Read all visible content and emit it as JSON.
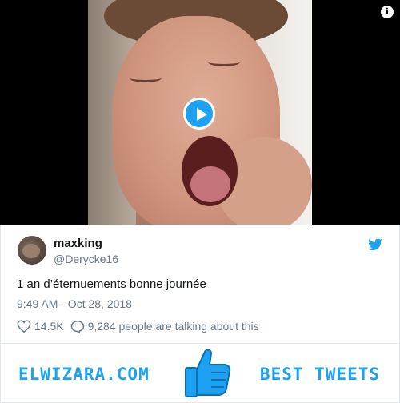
{
  "media": {
    "info_glyph": "i",
    "play_icon": "play-icon",
    "info_icon": "info-icon"
  },
  "tweet": {
    "display_name": "maxking",
    "handle": "@Derycke16",
    "text": "1 an d’éternuements bonne journée",
    "timestamp": "9:49 AM - Oct 28, 2018",
    "likes": "14.5K",
    "replies_text": "9,284 people are talking about this",
    "twitter_color": "#1da1f2"
  },
  "banner": {
    "left_text": "ELWIZARA.COM",
    "right_text": "BEST TWEETS",
    "icon": "thumbs-up-icon",
    "color": "#1da1f2"
  }
}
